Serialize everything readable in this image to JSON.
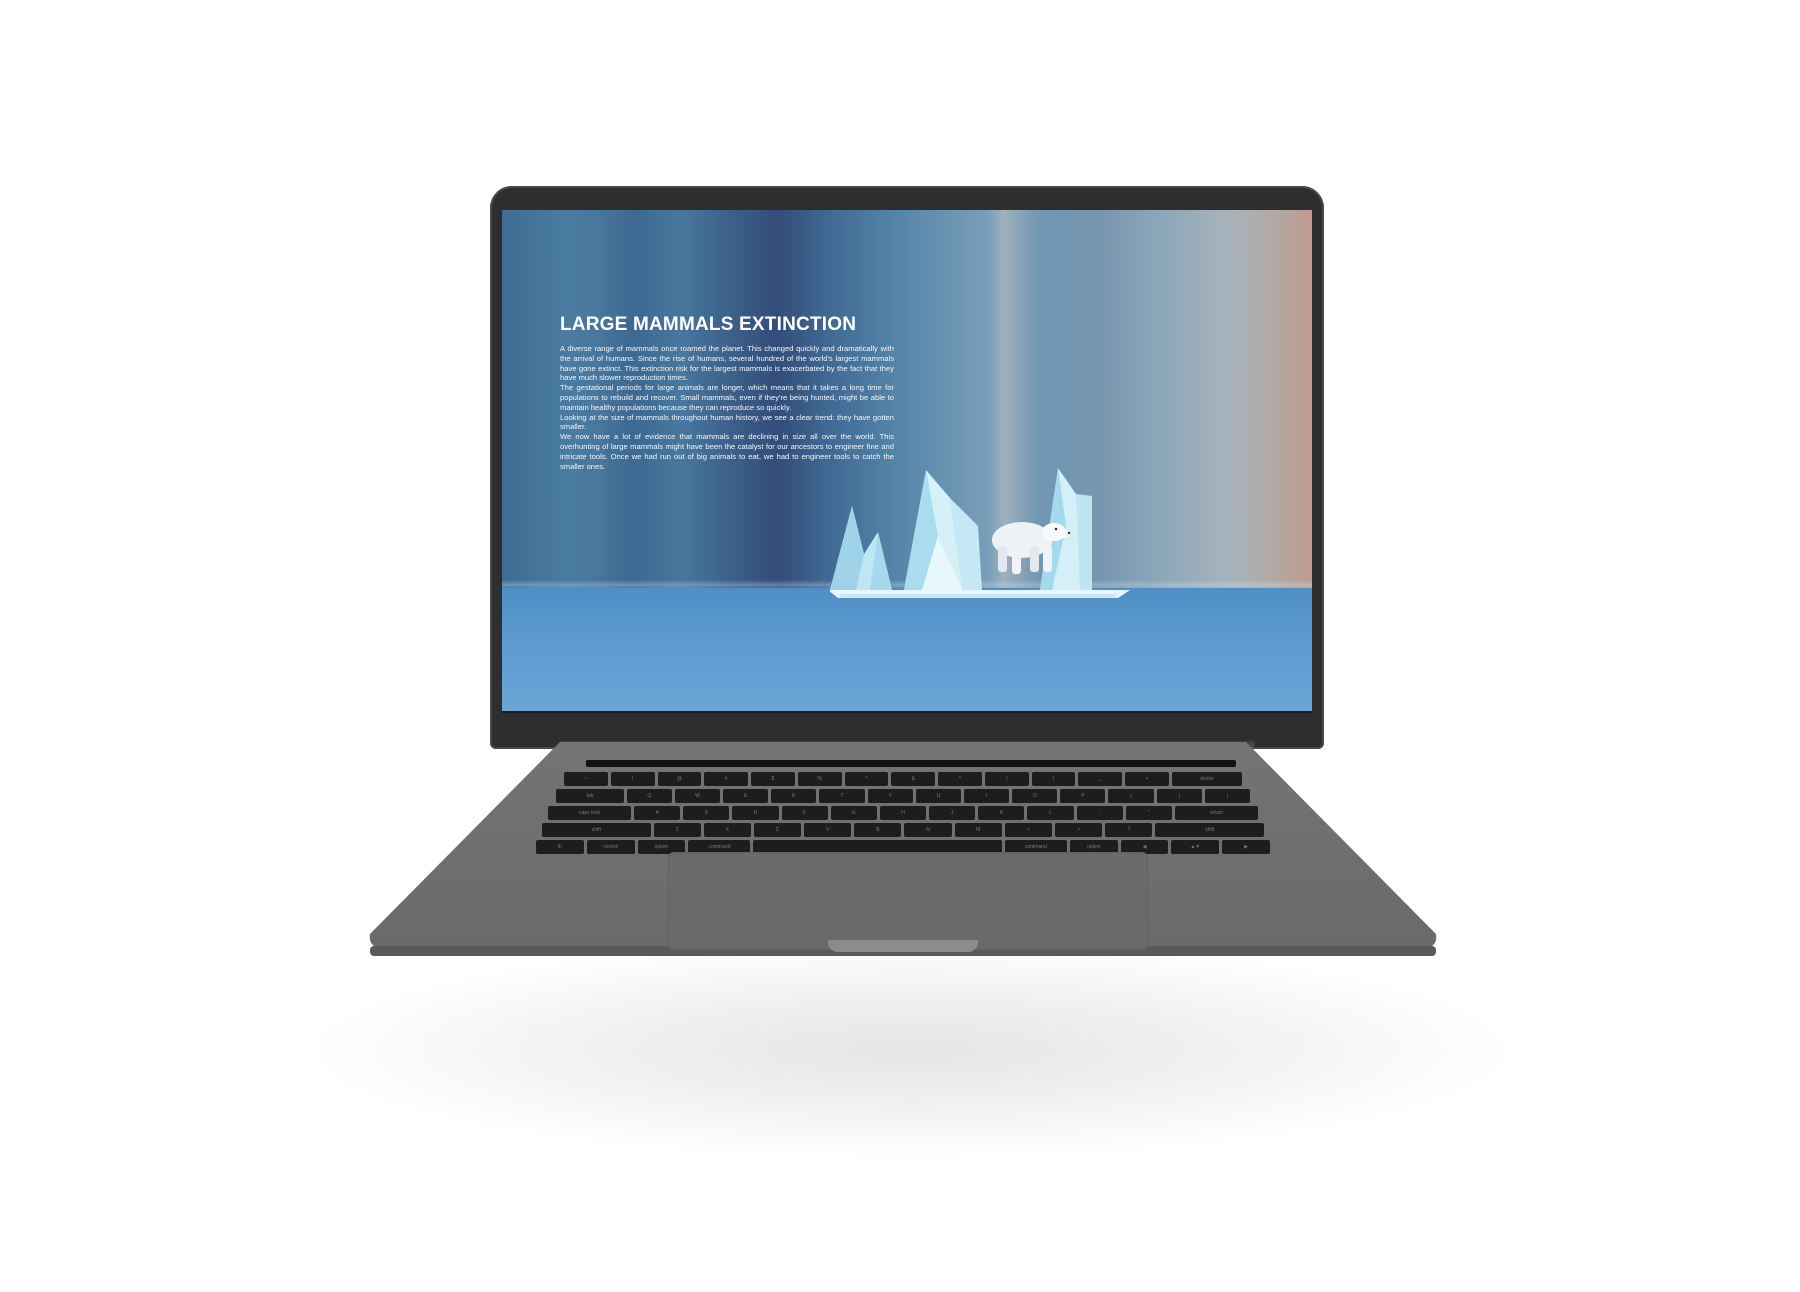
{
  "screen": {
    "article": {
      "title": "LARGE MAMMALS EXTINCTION",
      "paragraphs": [
        "A diverse range of mammals once roamed the planet. This changed quickly and dramatically with the arrival of humans. Since the rise of humans, several hundred of the world's largest mammals have gone extinct. This extinction risk for the largest mammals is exacerbated by the fact that they have much slower reproduction times.",
        "The gestational periods for large animals are longer, which means that it takes a long time for populations to rebuild and recover. Small mammals, even if they're being hunted, might be able to maintain healthy populations because they can reproduce so quickly.",
        "Looking at the size of mammals throughout human history, we see a clear trend: they have gotten smaller.",
        "We now have a lot of evidence that mammals are declining in size all over the world. This overhunting of large mammals might have been the catalyst for our ancestors to engineer fine and intricate tools. Once we had run out of big animals to eat, we had to engineer tools to catch the smaller ones."
      ]
    },
    "illustration": {
      "icon": "iceberg-polar-bear-icon"
    }
  },
  "keyboard": {
    "rows": [
      [
        "esc",
        "",
        "",
        "",
        "",
        "",
        "",
        "",
        "",
        "",
        "",
        "",
        "",
        "",
        ""
      ],
      [
        "~",
        "!",
        "@",
        "#",
        "$",
        "%",
        "^",
        "&",
        "*",
        "(",
        ")",
        "_",
        "+",
        "delete"
      ],
      [
        "tab",
        "Q",
        "W",
        "E",
        "R",
        "T",
        "Y",
        "U",
        "I",
        "O",
        "P",
        "{",
        "}",
        "|"
      ],
      [
        "caps lock",
        "A",
        "S",
        "D",
        "F",
        "G",
        "H",
        "J",
        "K",
        "L",
        ":",
        "\"",
        "return"
      ],
      [
        "shift",
        "Z",
        "X",
        "C",
        "V",
        "B",
        "N",
        "M",
        "<",
        ">",
        "?",
        "shift"
      ],
      [
        "fn",
        "control",
        "option",
        "command",
        "",
        "command",
        "option",
        "◀",
        "▲▼",
        "▶"
      ]
    ]
  },
  "colors": {
    "lid": "#2e2e30",
    "body": "#6e6e6e",
    "sea": "#5b99cf",
    "sky_left": "#3e6c93",
    "sky_right": "#c09a8c"
  }
}
